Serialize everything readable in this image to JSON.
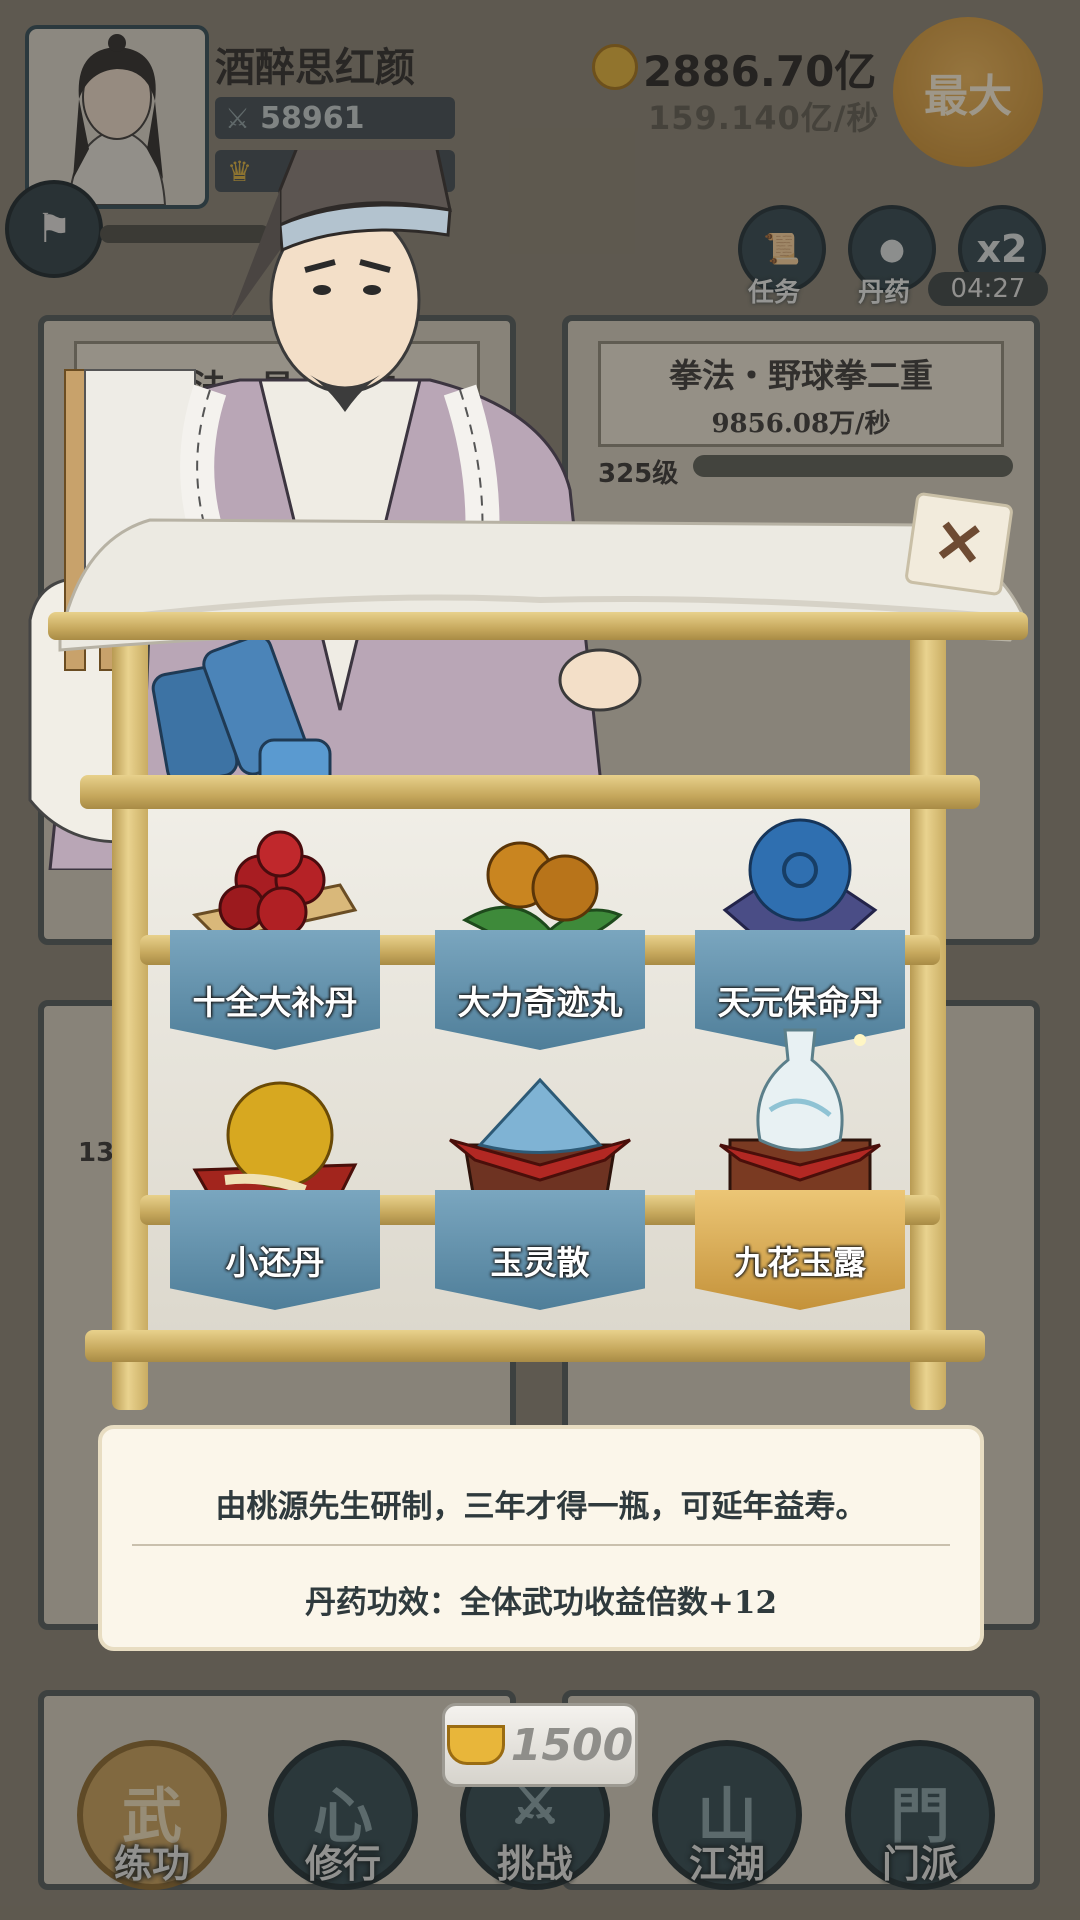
{
  "player": {
    "name": "酒醉思红颜",
    "power": "58961",
    "gold": "2886.70亿",
    "gold_rate": "159.140亿/秒",
    "max_label": "最大"
  },
  "top_buttons": [
    {
      "label": "任务",
      "icon": "scroll-icon"
    },
    {
      "label": "丹药",
      "icon": "pill-bowl-icon"
    },
    {
      "label": "x2",
      "timer": "04:27",
      "icon": "double-speed-icon"
    }
  ],
  "background_cards": {
    "left_title": "心法・易　　重",
    "right_title": "拳法・野球拳二重",
    "right_rate": "9856.08万/秒",
    "right_level": "325级",
    "left_level_fragment": "13"
  },
  "shop": {
    "items": [
      {
        "name": "十全大补丹",
        "icon": "red-pills-icon",
        "selected": false
      },
      {
        "name": "大力奇迹丸",
        "icon": "gold-pills-icon",
        "selected": false
      },
      {
        "name": "天元保命丹",
        "icon": "blue-orb-pill-icon",
        "selected": false
      },
      {
        "name": "小还丹",
        "icon": "golden-ginseng-pill-icon",
        "selected": false
      },
      {
        "name": "玉灵散",
        "icon": "jade-powder-icon",
        "selected": false
      },
      {
        "name": "九花玉露",
        "icon": "jade-vase-icon",
        "selected": true
      }
    ],
    "description": "由桃源先生研制，三年才得一瓶，可延年益寿。",
    "effect": "丹药功效：全体武功收益倍数+12",
    "price": "1500"
  },
  "bottom_nav": [
    {
      "label": "练功",
      "glyph": "武",
      "active": true
    },
    {
      "label": "修行",
      "glyph": "心",
      "active": false
    },
    {
      "label": "挑战",
      "glyph": "⚔",
      "active": false
    },
    {
      "label": "江湖",
      "glyph": "山",
      "active": false
    },
    {
      "label": "门派",
      "glyph": "門",
      "active": false
    }
  ]
}
